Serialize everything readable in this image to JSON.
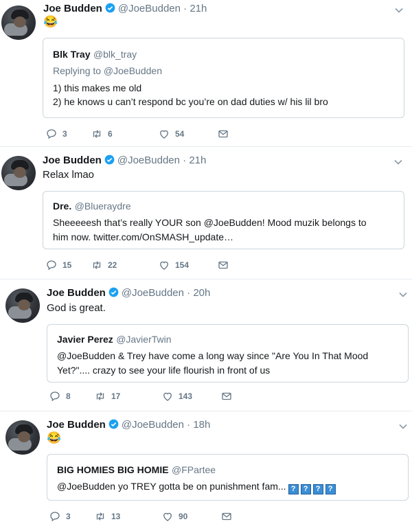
{
  "tweets": [
    {
      "name": "Joe Budden",
      "handle": "@JoeBudden",
      "time": "· 21h",
      "text": "😂",
      "quote": {
        "name": "Blk Tray",
        "handle": "@blk_tray",
        "reply_to": "Replying to @JoeBudden",
        "lines": [
          "1) this makes me old",
          "2) he knows u can’t respond bc you’re on dad duties w/ his lil bro"
        ]
      },
      "replies": "3",
      "retweets": "6",
      "likes": "54"
    },
    {
      "name": "Joe Budden",
      "handle": "@JoeBudden",
      "time": "· 21h",
      "text": "Relax lmao",
      "quote": {
        "name": "Dre.",
        "handle": "@Blueraydre",
        "lines": [
          "Sheeeeesh that’s really YOUR son @JoeBudden! Mood muzik belongs to",
          "him now. twitter.com/OnSMASH_update…"
        ]
      },
      "replies": "15",
      "retweets": "22",
      "likes": "154"
    },
    {
      "name": "Joe Budden",
      "handle": "@JoeBudden",
      "time": "· 20h",
      "text": "God is great.",
      "quote": {
        "name": "Javier Perez",
        "handle": "@JavierTwin",
        "lines": [
          "@JoeBudden & Trey have come a long way since \"Are You In That Mood",
          "Yet?\".... crazy to see your life flourish in front of us"
        ]
      },
      "replies": "8",
      "retweets": "17",
      "likes": "143"
    },
    {
      "name": "Joe Budden",
      "handle": "@JoeBudden",
      "time": "· 18h",
      "text": "😂",
      "quote": {
        "name": "BIG HOMIES BIG HOMIE",
        "handle": "@FPartee",
        "lines": [
          "@JoeBudden yo TREY gotta be on punishment fam..."
        ],
        "boxes": [
          "?",
          "?",
          "?",
          "?"
        ]
      },
      "replies": "3",
      "retweets": "13",
      "likes": "90"
    }
  ],
  "colors": {
    "accent": "#1da1f2",
    "muted": "#657786",
    "border": "#ccd6dd"
  },
  "icons": [
    "verified-badge-icon",
    "chevron-down-icon",
    "reply-icon",
    "retweet-icon",
    "like-icon",
    "direct-message-icon"
  ]
}
